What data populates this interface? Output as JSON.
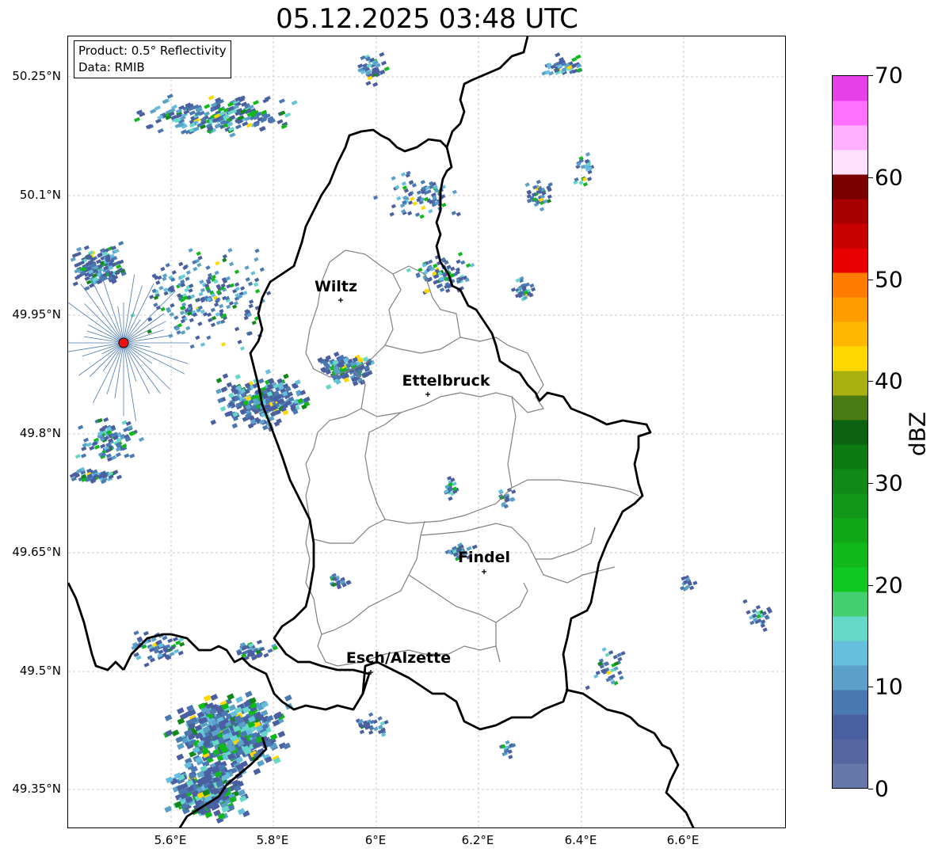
{
  "title": "05.12.2025 03:48 UTC",
  "info": {
    "product": "Product: 0.5° Reflectivity",
    "data": "Data: RMIB"
  },
  "axes": {
    "lat_labels": [
      "50.25°N",
      "50.1°N",
      "49.95°N",
      "49.8°N",
      "49.65°N",
      "49.5°N",
      "49.35°N"
    ],
    "lon_labels": [
      "5.6°E",
      "5.8°E",
      "6°E",
      "6.2°E",
      "6.4°E",
      "6.6°E"
    ],
    "grid": true
  },
  "cities": [
    {
      "name": "Wiltz"
    },
    {
      "name": "Ettelbruck"
    },
    {
      "name": "Findel"
    },
    {
      "name": "Esch/Alzette"
    }
  ],
  "colorbar": {
    "label": "dBZ",
    "ticks": [
      "0",
      "10",
      "20",
      "30",
      "40",
      "50",
      "60",
      "70"
    ],
    "colors": [
      "#6677aa",
      "#5566a0",
      "#4a5fa0",
      "#4a78b0",
      "#5aa0c8",
      "#66c0dd",
      "#66d8c8",
      "#44d070",
      "#11c822",
      "#11b81a",
      "#11a818",
      "#119818",
      "#118818",
      "#0e7a12",
      "#0c6210",
      "#4a7a12",
      "#aab010",
      "#ffd800",
      "#ffb800",
      "#ff9c00",
      "#ff7c00",
      "#e80000",
      "#c80000",
      "#a80000",
      "#7a0000",
      "#ffe0ff",
      "#ffb0ff",
      "#ff70ff",
      "#e840e8"
    ]
  },
  "markers": {
    "radar_site_color": "#ee1111"
  },
  "colors": {
    "country_border": "#000000",
    "canton_border": "#808080",
    "grid": "#bbbbbb"
  }
}
